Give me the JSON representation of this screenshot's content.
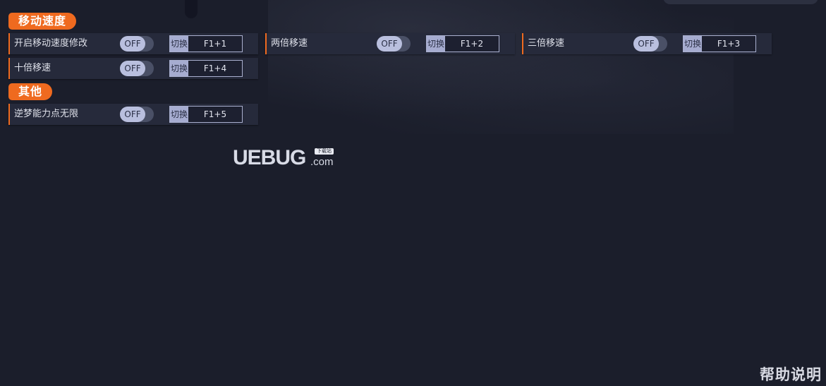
{
  "sections": [
    {
      "title": "移动速度"
    },
    {
      "title": "其他"
    }
  ],
  "cheats": [
    {
      "label": "开启移动速度修改",
      "state": "OFF",
      "hotkey_label": "切换",
      "hotkey": "F1+1"
    },
    {
      "label": "两倍移速",
      "state": "OFF",
      "hotkey_label": "切换",
      "hotkey": "F1+2"
    },
    {
      "label": "三倍移速",
      "state": "OFF",
      "hotkey_label": "切换",
      "hotkey": "F1+3"
    },
    {
      "label": "十倍移速",
      "state": "OFF",
      "hotkey_label": "切换",
      "hotkey": "F1+4"
    },
    {
      "label": "逆梦能力点无限",
      "state": "OFF",
      "hotkey_label": "切换",
      "hotkey": "F1+5"
    }
  ],
  "watermark": {
    "brand": "UEBUG",
    "domain": ".com",
    "badge": "下载站"
  },
  "help_label": "帮助说明",
  "colors": {
    "accent": "#ef6a1f",
    "background": "#1b1e2b",
    "row_background": "#262a3b",
    "toggle_knob": "#b9bfde"
  }
}
